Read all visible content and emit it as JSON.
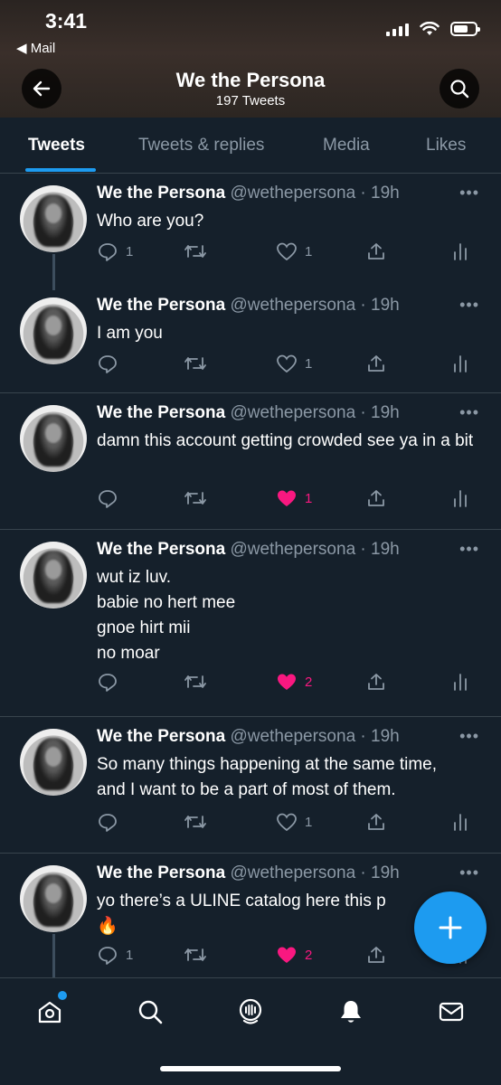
{
  "status_bar": {
    "time": "3:41",
    "back_app": "◀ Mail"
  },
  "profile_header": {
    "title": "We the Persona",
    "tweet_count": "197 Tweets"
  },
  "tabs": [
    {
      "label": "Tweets",
      "active": true
    },
    {
      "label": "Tweets & replies",
      "active": false
    },
    {
      "label": "Media",
      "active": false
    },
    {
      "label": "Likes",
      "active": false
    }
  ],
  "tweets": [
    {
      "name": "We the Persona",
      "handle": "@wethepersona",
      "time": "· 19h",
      "lines": [
        "Who are you?"
      ],
      "replies": "1",
      "retweets": "",
      "likes": "1",
      "liked": false
    },
    {
      "name": "We the Persona",
      "handle": "@wethepersona",
      "time": "· 19h",
      "lines": [
        "I am you"
      ],
      "replies": "",
      "retweets": "",
      "likes": "1",
      "liked": false
    },
    {
      "name": "We the Persona",
      "handle": "@wethepersona",
      "time": "· 19h",
      "lines": [
        "damn this account getting crowded see ya in a bit"
      ],
      "replies": "",
      "retweets": "",
      "likes": "1",
      "liked": true
    },
    {
      "name": "We the Persona",
      "handle": "@wethepersona",
      "time": "· 19h",
      "lines": [
        "wut iz luv.",
        "babie no hert mee",
        "gnoe hirt mii",
        "no moar"
      ],
      "replies": "",
      "retweets": "",
      "likes": "2",
      "liked": true
    },
    {
      "name": "We the Persona",
      "handle": "@wethepersona",
      "time": "· 19h",
      "lines": [
        "So many things happening at the same time,",
        "and I want to be a part of most of them."
      ],
      "replies": "",
      "retweets": "",
      "likes": "1",
      "liked": false
    },
    {
      "name": "We the Persona",
      "handle": "@wethepersona",
      "time": "· 19h",
      "lines": [
        "yo there’s a ULINE catalog here this p",
        "🔥"
      ],
      "replies": "1",
      "retweets": "",
      "likes": "2",
      "liked": true
    }
  ],
  "colors": {
    "background": "#15202b",
    "accent": "#1d9bf0",
    "like": "#f91880",
    "muted": "#8b98a5"
  },
  "icons": {
    "back": "arrow-left-icon",
    "search": "search-icon",
    "reply": "speech-bubble-icon",
    "retweet": "retweet-icon",
    "like": "heart-icon",
    "share": "share-icon",
    "analytics": "analytics-icon",
    "compose": "plus-icon",
    "nav": [
      "home-icon",
      "search-icon",
      "spaces-icon",
      "bell-icon",
      "mail-icon"
    ]
  }
}
